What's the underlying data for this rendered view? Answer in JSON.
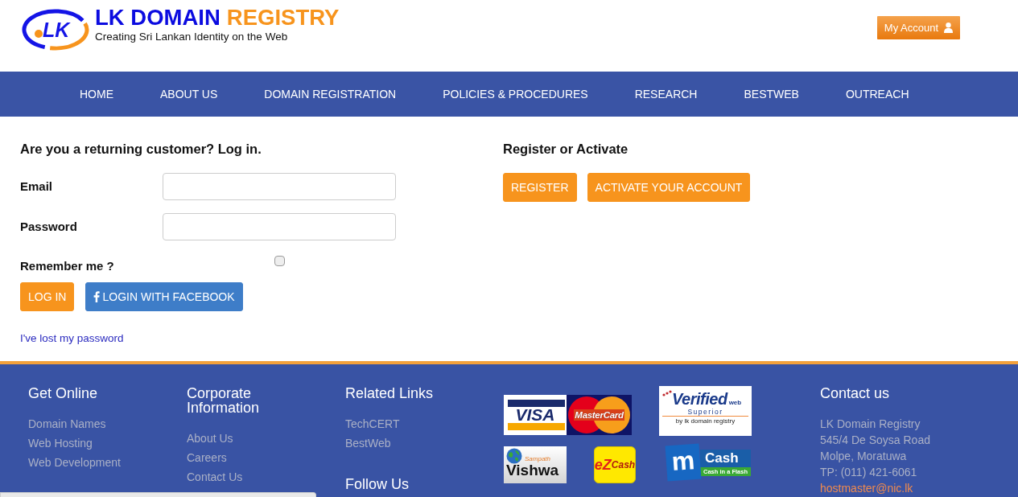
{
  "header": {
    "logo": {
      "mark": "LK",
      "name": "LK DOMAIN",
      "name_accent": "REGISTRY",
      "tagline": "Creating Sri Lankan Identity on the Web"
    },
    "account_button": "My Account"
  },
  "nav": [
    "HOME",
    "ABOUT US",
    "DOMAIN REGISTRATION",
    "POLICIES & PROCEDURES",
    "RESEARCH",
    "BESTWEB",
    "OUTREACH"
  ],
  "login": {
    "title": "Are you a returning customer? Log in.",
    "fields": [
      {
        "label": "Email"
      },
      {
        "label": "Password"
      }
    ],
    "remember": {
      "label": "Remember me ?",
      "checked": false
    },
    "buttons": [
      {
        "label": "LOG IN",
        "kind": "primary"
      },
      {
        "label": "LOGIN WITH FACEBOOK",
        "kind": "facebook"
      }
    ],
    "lost_password": "I've lost my password"
  },
  "register": {
    "title": "Register or Activate",
    "buttons": [
      "REGISTER",
      "ACTIVATE YOUR ACCOUNT"
    ]
  },
  "footer": {
    "columns": [
      {
        "title": "Get Online",
        "links": [
          "Domain Names",
          "Web Hosting",
          "Web Development"
        ]
      },
      {
        "title": "Corporate Information",
        "links": [
          "About Us",
          "Careers",
          "Contact Us"
        ]
      },
      {
        "title": "Related Links",
        "links": [
          "TechCERT",
          "BestWeb"
        ]
      }
    ],
    "follow_title": "Follow Us",
    "badges": {
      "cards": {
        "visa": "VISA",
        "mastercard": "MasterCard"
      },
      "verified": {
        "title": "Verified",
        "suffix": "web",
        "subtitle": "Superior",
        "byline": "by lk domain registry"
      },
      "vishwa": {
        "brand": "Sampath",
        "name": "Vishwa"
      },
      "ezcash": {
        "accent": "eZ",
        "name": "Cash"
      },
      "mcash": {
        "letter": "m",
        "name": "Cash",
        "slogan": "Cash in a Flash"
      }
    },
    "contact": {
      "title": "Contact us",
      "lines": [
        "LK Domain Registry",
        "545/4 De Soysa Road",
        "Molpe, Moratuwa",
        "TP: (011) 421-6061"
      ],
      "email": "hostmaster@nic.lk"
    }
  }
}
